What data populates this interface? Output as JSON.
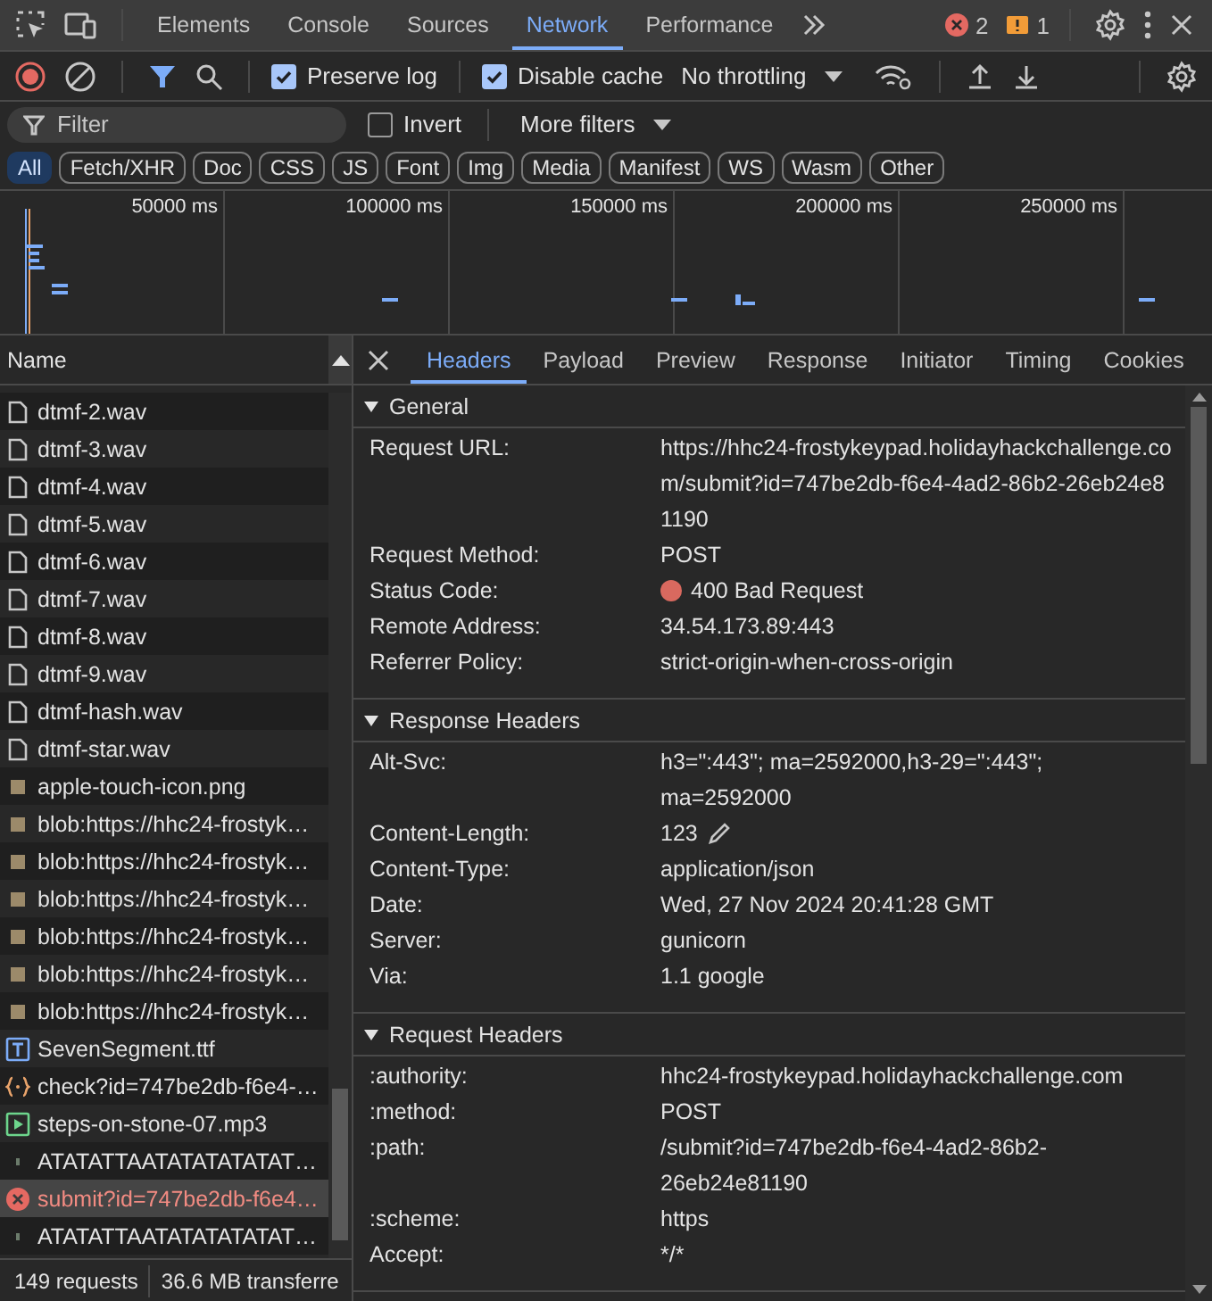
{
  "main_tabs": [
    {
      "label": "Elements",
      "selected": false
    },
    {
      "label": "Console",
      "selected": false
    },
    {
      "label": "Sources",
      "selected": false
    },
    {
      "label": "Network",
      "selected": true
    },
    {
      "label": "Performance",
      "selected": false
    }
  ],
  "issue_counts": {
    "errors": "2",
    "warnings": "1"
  },
  "toolbar": {
    "preserve_log": {
      "label": "Preserve log",
      "checked": true
    },
    "disable_cache": {
      "label": "Disable cache",
      "checked": true
    },
    "throttling": "No throttling"
  },
  "filter": {
    "placeholder": "Filter",
    "invert": {
      "label": "Invert",
      "checked": false
    },
    "more_filters": "More filters"
  },
  "type_filters": [
    {
      "label": "All",
      "selected": true
    },
    {
      "label": "Fetch/XHR",
      "selected": false
    },
    {
      "label": "Doc",
      "selected": false
    },
    {
      "label": "CSS",
      "selected": false
    },
    {
      "label": "JS",
      "selected": false
    },
    {
      "label": "Font",
      "selected": false
    },
    {
      "label": "Img",
      "selected": false
    },
    {
      "label": "Media",
      "selected": false
    },
    {
      "label": "Manifest",
      "selected": false
    },
    {
      "label": "WS",
      "selected": false
    },
    {
      "label": "Wasm",
      "selected": false
    },
    {
      "label": "Other",
      "selected": false
    }
  ],
  "overview": {
    "ticks": [
      "50000 ms",
      "100000 ms",
      "150000 ms",
      "200000 ms",
      "250000 ms"
    ]
  },
  "requests_header": "Name",
  "requests": [
    {
      "name": "dtmf-2.wav",
      "kind": "file",
      "selected": false
    },
    {
      "name": "dtmf-3.wav",
      "kind": "file",
      "selected": false
    },
    {
      "name": "dtmf-4.wav",
      "kind": "file",
      "selected": false
    },
    {
      "name": "dtmf-5.wav",
      "kind": "file",
      "selected": false
    },
    {
      "name": "dtmf-6.wav",
      "kind": "file",
      "selected": false
    },
    {
      "name": "dtmf-7.wav",
      "kind": "file",
      "selected": false
    },
    {
      "name": "dtmf-8.wav",
      "kind": "file",
      "selected": false
    },
    {
      "name": "dtmf-9.wav",
      "kind": "file",
      "selected": false
    },
    {
      "name": "dtmf-hash.wav",
      "kind": "file",
      "selected": false
    },
    {
      "name": "dtmf-star.wav",
      "kind": "file",
      "selected": false
    },
    {
      "name": "apple-touch-icon.png",
      "kind": "image",
      "selected": false
    },
    {
      "name": "blob:https://hhc24-frostyk…",
      "kind": "image",
      "selected": false
    },
    {
      "name": "blob:https://hhc24-frostyk…",
      "kind": "image",
      "selected": false
    },
    {
      "name": "blob:https://hhc24-frostyk…",
      "kind": "image",
      "selected": false
    },
    {
      "name": "blob:https://hhc24-frostyk…",
      "kind": "image",
      "selected": false
    },
    {
      "name": "blob:https://hhc24-frostyk…",
      "kind": "image",
      "selected": false
    },
    {
      "name": "blob:https://hhc24-frostyk…",
      "kind": "image",
      "selected": false
    },
    {
      "name": "SevenSegment.ttf",
      "kind": "font",
      "selected": false
    },
    {
      "name": "check?id=747be2db-f6e4-…",
      "kind": "script",
      "selected": false
    },
    {
      "name": "steps-on-stone-07.mp3",
      "kind": "media",
      "selected": false
    },
    {
      "name": "ATATATTAATATATATATAT…",
      "kind": "other",
      "selected": false
    },
    {
      "name": "submit?id=747be2db-f6e4…",
      "kind": "error",
      "selected": true
    },
    {
      "name": "ATATATTAATATATATATAT…",
      "kind": "other",
      "selected": false
    }
  ],
  "status_bar": [
    "149 requests",
    "36.6 MB transferre"
  ],
  "detail_tabs": [
    {
      "label": "Headers",
      "selected": true
    },
    {
      "label": "Payload",
      "selected": false
    },
    {
      "label": "Preview",
      "selected": false
    },
    {
      "label": "Response",
      "selected": false
    },
    {
      "label": "Initiator",
      "selected": false
    },
    {
      "label": "Timing",
      "selected": false
    },
    {
      "label": "Cookies",
      "selected": false
    }
  ],
  "sections": [
    {
      "title": "General",
      "expanded": true,
      "rows": [
        {
          "name": "Request URL:",
          "value": "https://hhc24-frostykeypad.holidayhackchallenge.com/submit?id=747be2db-f6e4-4ad2-86b2-26eb24e81190",
          "kind": "url"
        },
        {
          "name": "Request Method:",
          "value": "POST",
          "kind": "text"
        },
        {
          "name": "Status Code:",
          "value": "400 Bad Request",
          "kind": "status",
          "color": "#d9695f"
        },
        {
          "name": "Remote Address:",
          "value": "34.54.173.89:443",
          "kind": "text"
        },
        {
          "name": "Referrer Policy:",
          "value": "strict-origin-when-cross-origin",
          "kind": "text"
        }
      ]
    },
    {
      "title": "Response Headers",
      "expanded": true,
      "rows": [
        {
          "name": "Alt-Svc:",
          "value": "h3=\":443\"; ma=2592000,h3-29=\":443\"; ma=2592000",
          "kind": "text"
        },
        {
          "name": "Content-Length:",
          "value": "123",
          "kind": "editable"
        },
        {
          "name": "Content-Type:",
          "value": "application/json",
          "kind": "text"
        },
        {
          "name": "Date:",
          "value": "Wed, 27 Nov 2024 20:41:28 GMT",
          "kind": "text"
        },
        {
          "name": "Server:",
          "value": "gunicorn",
          "kind": "text"
        },
        {
          "name": "Via:",
          "value": "1.1 google",
          "kind": "text"
        }
      ]
    },
    {
      "title": "Request Headers",
      "expanded": true,
      "rows": [
        {
          "name": ":authority:",
          "value": "hhc24-frostykeypad.holidayhackchallenge.com",
          "kind": "text"
        },
        {
          "name": ":method:",
          "value": "POST",
          "kind": "text"
        },
        {
          "name": ":path:",
          "value": "/submit?id=747be2db-f6e4-4ad2-86b2-26eb24e81190",
          "kind": "text"
        },
        {
          "name": ":scheme:",
          "value": "https",
          "kind": "text"
        },
        {
          "name": "Accept:",
          "value": "*/*",
          "kind": "text"
        }
      ]
    }
  ]
}
